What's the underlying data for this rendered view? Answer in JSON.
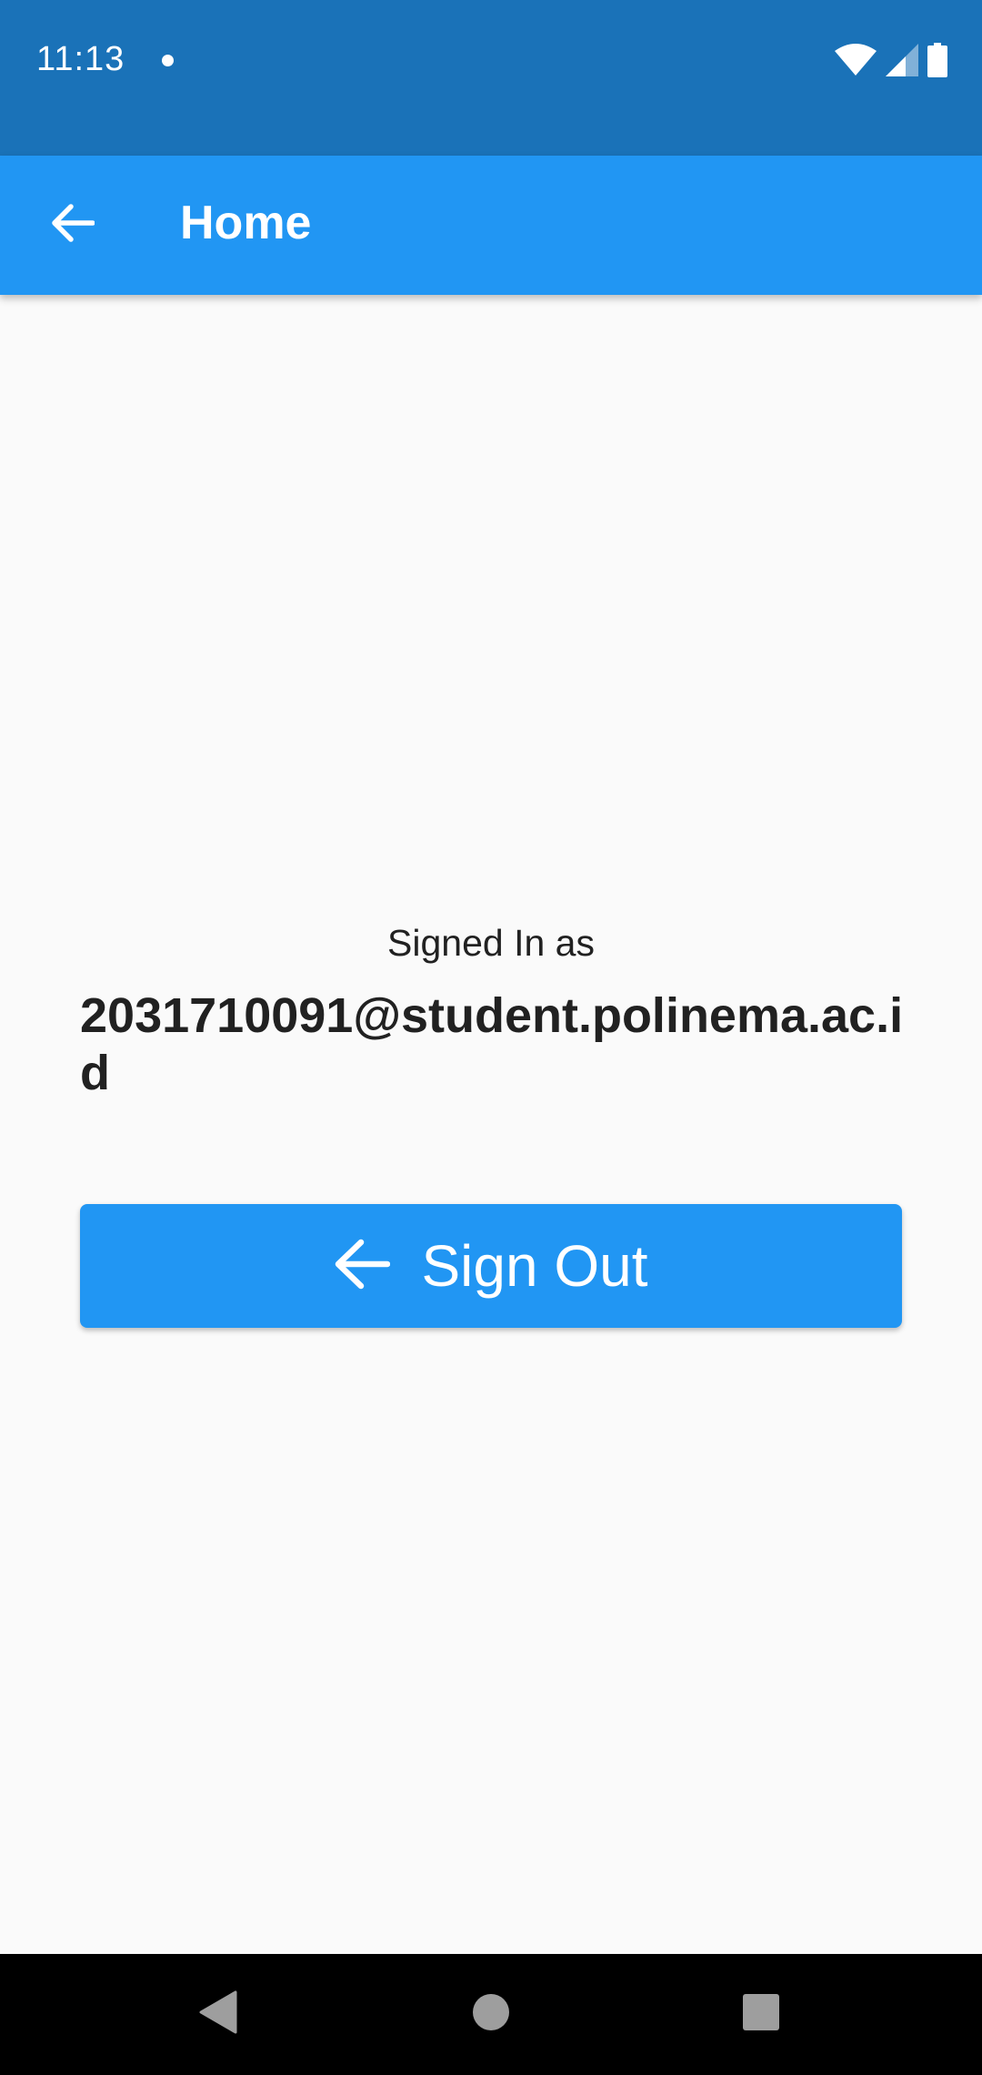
{
  "status_bar": {
    "time": "11:13",
    "icons": [
      "notification-dot-icon",
      "wifi-icon",
      "cell-signal-icon",
      "battery-icon"
    ]
  },
  "app_bar": {
    "title": "Home",
    "back_icon": "arrow-back-icon"
  },
  "main": {
    "signed_in_label": "Signed In as",
    "email": "2031710091@student.polinema.ac.id",
    "sign_out_label": "Sign Out",
    "sign_out_icon": "arrow-back-icon"
  },
  "nav_bar": {
    "buttons": [
      "back-nav-icon",
      "home-nav-icon",
      "recents-nav-icon"
    ]
  },
  "colors": {
    "status_bar": "#1a72b8",
    "app_bar": "#2196f3",
    "button": "#2196f3",
    "background": "#fafafa",
    "text": "#212121",
    "nav_bar": "#000000"
  }
}
